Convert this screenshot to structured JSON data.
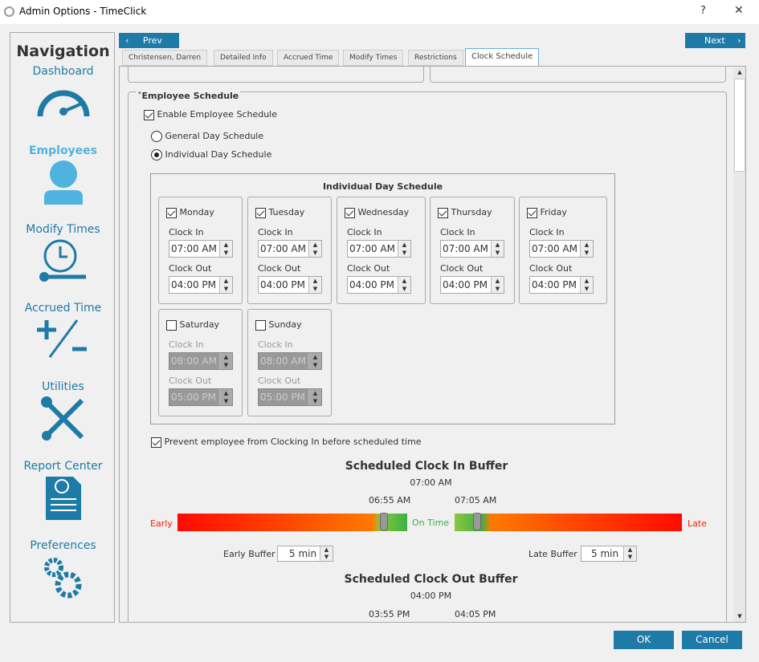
{
  "window": {
    "title": "Admin Options - TimeClick",
    "help": "?",
    "close": "✕"
  },
  "nav": {
    "heading": "Navigation",
    "items": [
      {
        "label": "Dashboard",
        "icon": "speedometer-icon"
      },
      {
        "label": "Employees",
        "icon": "person-icon",
        "active": true
      },
      {
        "label": "Modify Times",
        "icon": "clock-wrench-icon"
      },
      {
        "label": "Accrued Time",
        "icon": "plus-minus-icon"
      },
      {
        "label": "Utilities",
        "icon": "tools-icon"
      },
      {
        "label": "Report Center",
        "icon": "report-icon"
      },
      {
        "label": "Preferences",
        "icon": "gears-icon"
      }
    ]
  },
  "toolbar": {
    "prev": "Prev",
    "next": "Next"
  },
  "tabs": [
    "Christensen, Darren",
    "Detailed Info",
    "Accrued Time",
    "Modify Times",
    "Restrictions",
    "Clock Schedule"
  ],
  "active_tab": "Clock Schedule",
  "schedule": {
    "section_title": "Employee Schedule",
    "enable_label": "Enable Employee Schedule",
    "enable_checked": true,
    "general_label": "General Day Schedule",
    "individual_label": "Individual Day Schedule",
    "selected": "individual",
    "box_title": "Individual Day Schedule",
    "clock_in_label": "Clock In",
    "clock_out_label": "Clock Out",
    "days": [
      {
        "name": "Monday",
        "checked": true,
        "in": "07:00 AM",
        "out": "04:00 PM"
      },
      {
        "name": "Tuesday",
        "checked": true,
        "in": "07:00 AM",
        "out": "04:00 PM"
      },
      {
        "name": "Wednesday",
        "checked": true,
        "in": "07:00 AM",
        "out": "04:00 PM"
      },
      {
        "name": "Thursday",
        "checked": true,
        "in": "07:00 AM",
        "out": "04:00 PM"
      },
      {
        "name": "Friday",
        "checked": true,
        "in": "07:00 AM",
        "out": "04:00 PM"
      },
      {
        "name": "Saturday",
        "checked": false,
        "in": "08:00 AM",
        "out": "05:00 PM"
      },
      {
        "name": "Sunday",
        "checked": false,
        "in": "08:00 AM",
        "out": "05:00 PM"
      }
    ],
    "prevent_label": "Prevent employee from Clocking In before scheduled time",
    "prevent_checked": true
  },
  "clock_in_buffer": {
    "title": "Scheduled Clock In Buffer",
    "time": "07:00 AM",
    "early_time": "06:55 AM",
    "late_time": "07:05 AM",
    "early": "Early",
    "on_time": "On Time",
    "late": "Late",
    "early_buffer_label": "Early Buffer",
    "early_buffer": "5 min",
    "late_buffer_label": "Late Buffer",
    "late_buffer": "5 min"
  },
  "clock_out_buffer": {
    "title": "Scheduled Clock Out Buffer",
    "time": "04:00 PM",
    "early_time": "03:55 PM",
    "late_time": "04:05 PM"
  },
  "footer": {
    "ok": "OK",
    "cancel": "Cancel"
  },
  "colors": {
    "accent": "#1e7aa6",
    "active_nav": "#4fb3e0",
    "early": "#ff1a00",
    "on_time": "#3cb043",
    "late": "#ff1a00"
  }
}
